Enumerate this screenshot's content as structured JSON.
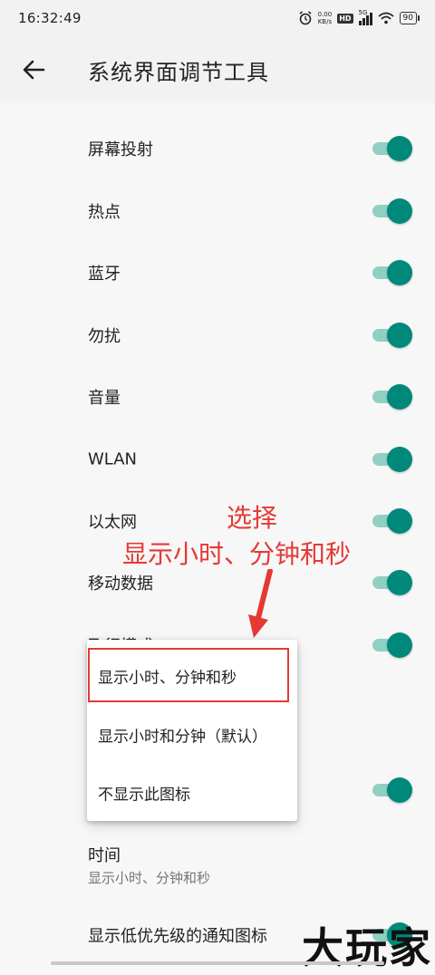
{
  "status_bar": {
    "time": "16:32:49",
    "net_speed_value": "0.00",
    "net_speed_unit": "KB/s",
    "hd_label": "HD",
    "signal_label": "5G",
    "battery": "90"
  },
  "app_bar": {
    "title": "系统界面调节工具",
    "back_icon": "arrow-back-icon"
  },
  "settings": [
    {
      "label": "屏幕投射",
      "enabled": true
    },
    {
      "label": "热点",
      "enabled": true
    },
    {
      "label": "蓝牙",
      "enabled": true
    },
    {
      "label": "勿扰",
      "enabled": true
    },
    {
      "label": "音量",
      "enabled": true
    },
    {
      "label": "WLAN",
      "enabled": true
    },
    {
      "label": "以太网",
      "enabled": true
    },
    {
      "label": "移动数据",
      "enabled": true
    },
    {
      "label": "飞行模式",
      "enabled": true
    },
    {
      "label": "",
      "enabled": true
    }
  ],
  "time_setting": {
    "title": "时间",
    "subtitle": "显示小时、分钟和秒"
  },
  "last_setting": {
    "label": "显示低优先级的通知图标",
    "enabled": true
  },
  "popup": {
    "options": [
      "显示小时、分钟和秒",
      "显示小时和分钟（默认）",
      "不显示此图标"
    ],
    "selected_index": 0
  },
  "annotation": {
    "line1": "选择",
    "line2": "显示小时、分钟和秒",
    "color": "#e53935"
  },
  "watermark": "大玩家",
  "colors": {
    "accent": "#00897b",
    "track": "#8fd0c3",
    "background": "#f7f7f7"
  }
}
